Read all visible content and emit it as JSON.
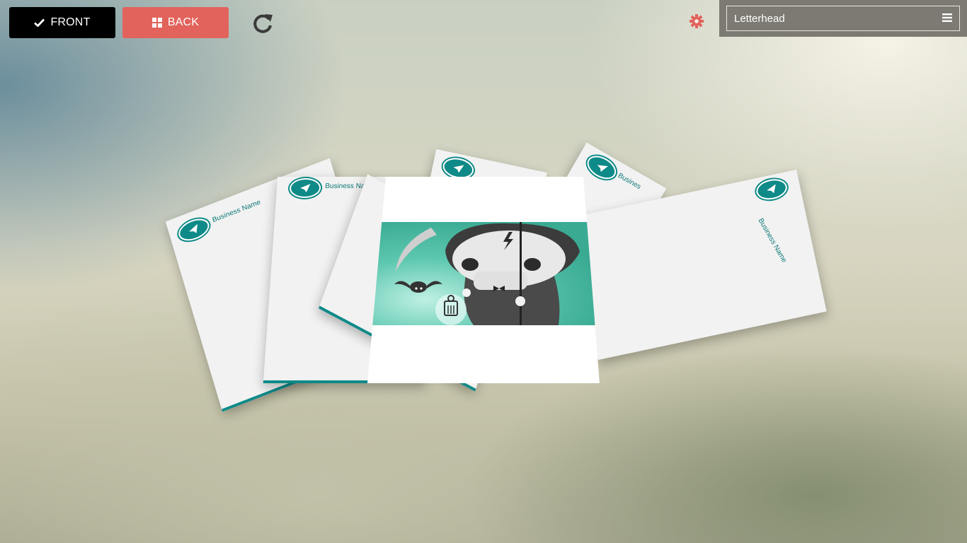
{
  "toolbar": {
    "front_label": "FRONT",
    "back_label": "BACK"
  },
  "product_select": {
    "value": "Letterhead"
  },
  "letterheads": {
    "business_name": "Business Name",
    "business_name_short": "Business Na",
    "business_name_cut": "Busines"
  },
  "colors": {
    "front_button": "#000000",
    "back_button": "#e2635c",
    "gear": "#e2635c",
    "brand_teal": "#0e8a88"
  },
  "icons": [
    "check-icon",
    "grid-icon",
    "refresh-icon",
    "gear-icon",
    "menu-icon",
    "paper-plane-icon"
  ]
}
